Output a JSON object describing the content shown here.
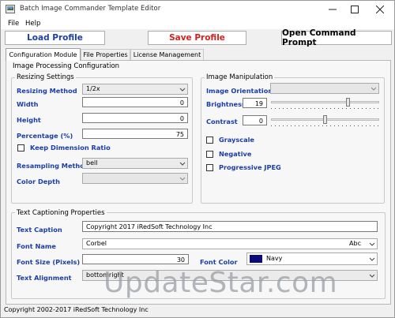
{
  "window": {
    "title": "Batch Image Commander Template Editor"
  },
  "menu": [
    "File",
    "Help"
  ],
  "toolbar": {
    "load_label": "Load Profile",
    "save_label": "Save Profile",
    "cmd_label": "Open Command Prompt",
    "load_color": "#1b3ea8",
    "save_color": "#d81e1e",
    "cmd_color": "#000000"
  },
  "tabs": [
    "Configuration Module",
    "File Properties",
    "License Management"
  ],
  "processing": {
    "title": "Image Processing Configuration",
    "resizing": {
      "title": "Resizing Settings",
      "method_label": "Resizing Method",
      "method_value": "1/2x",
      "width_label": "Width",
      "width_value": "0",
      "height_label": "Height",
      "height_value": "0",
      "percentage_label": "Percentage (%)",
      "percentage_value": "75",
      "keep_ratio_label": "Keep Dimension Ratio",
      "keep_ratio_checked": false,
      "resampling_label": "Resampling Method",
      "resampling_value": "bell",
      "color_depth_label": "Color Depth",
      "color_depth_value": ""
    },
    "manipulation": {
      "title": "Image Manipulation",
      "orientation_label": "Image Orientation",
      "orientation_value": "",
      "brightness_label": "Brightness",
      "brightness_value": "19",
      "brightness_level": 0.72,
      "contrast_label": "Contrast",
      "contrast_value": "0",
      "contrast_level": 0.5,
      "grayscale_label": "Grayscale",
      "negative_label": "Negative",
      "progressive_label": "Progressive JPEG"
    }
  },
  "captioning": {
    "title": "Text Captioning Properties",
    "caption_label": "Text Caption",
    "caption_value": "Copyright 2017 iRedSoft Technology Inc",
    "font_name_label": "Font Name",
    "font_name_value": "Corbel",
    "font_sample": "Abc",
    "font_size_label": "Font Size (Pixels)",
    "font_size_value": "30",
    "font_color_label": "Font Color",
    "font_color_value": "Navy",
    "font_color_swatch": "#0a0a7a",
    "alignment_label": "Text Alignment",
    "alignment_value": "bottomright"
  },
  "status": "Copyright 2002-2017 iRedSoft Technology Inc",
  "watermark": "UpdateStar.com"
}
